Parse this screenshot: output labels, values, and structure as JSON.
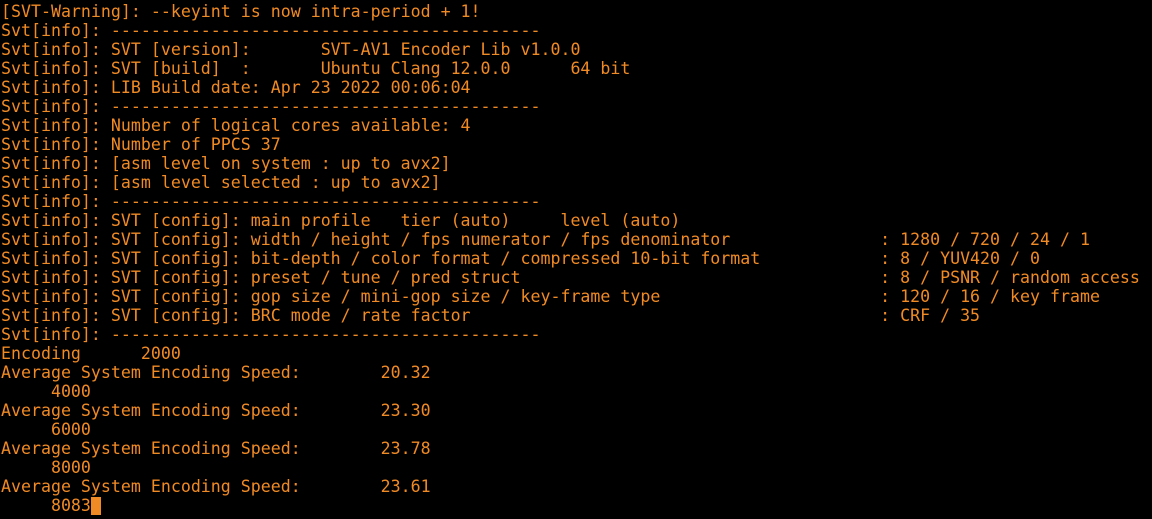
{
  "terminal": {
    "colors": {
      "background": "#000000",
      "foreground": "#f08a24",
      "cursor": "#f08a24"
    },
    "lines": [
      "[SVT-Warning]: --keyint is now intra-period + 1!",
      "Svt[info]: -------------------------------------------",
      "Svt[info]: SVT [version]:       SVT-AV1 Encoder Lib v1.0.0",
      "Svt[info]: SVT [build]  :       Ubuntu Clang 12.0.0      64 bit",
      "Svt[info]: LIB Build date: Apr 23 2022 00:06:04",
      "Svt[info]: -------------------------------------------",
      "Svt[info]: Number of logical cores available: 4",
      "Svt[info]: Number of PPCS 37",
      "Svt[info]: [asm level on system : up to avx2]",
      "Svt[info]: [asm level selected : up to avx2]",
      "Svt[info]: -------------------------------------------",
      "Svt[info]: SVT [config]: main profile   tier (auto)     level (auto)",
      "Svt[info]: SVT [config]: width / height / fps numerator / fps denominator               : 1280 / 720 / 24 / 1",
      "Svt[info]: SVT [config]: bit-depth / color format / compressed 10-bit format            : 8 / YUV420 / 0",
      "Svt[info]: SVT [config]: preset / tune / pred struct                                    : 8 / PSNR / random access",
      "Svt[info]: SVT [config]: gop size / mini-gop size / key-frame type                      : 120 / 16 / key frame",
      "Svt[info]: SVT [config]: BRC mode / rate factor                                         : CRF / 35",
      "Svt[info]: -------------------------------------------",
      "Encoding      2000",
      "Average System Encoding Speed:        20.32",
      "     4000",
      "Average System Encoding Speed:        23.30",
      "     6000",
      "Average System Encoding Speed:        23.78",
      "     8000",
      "Average System Encoding Speed:        23.61"
    ],
    "prompt_line": "     8083"
  }
}
